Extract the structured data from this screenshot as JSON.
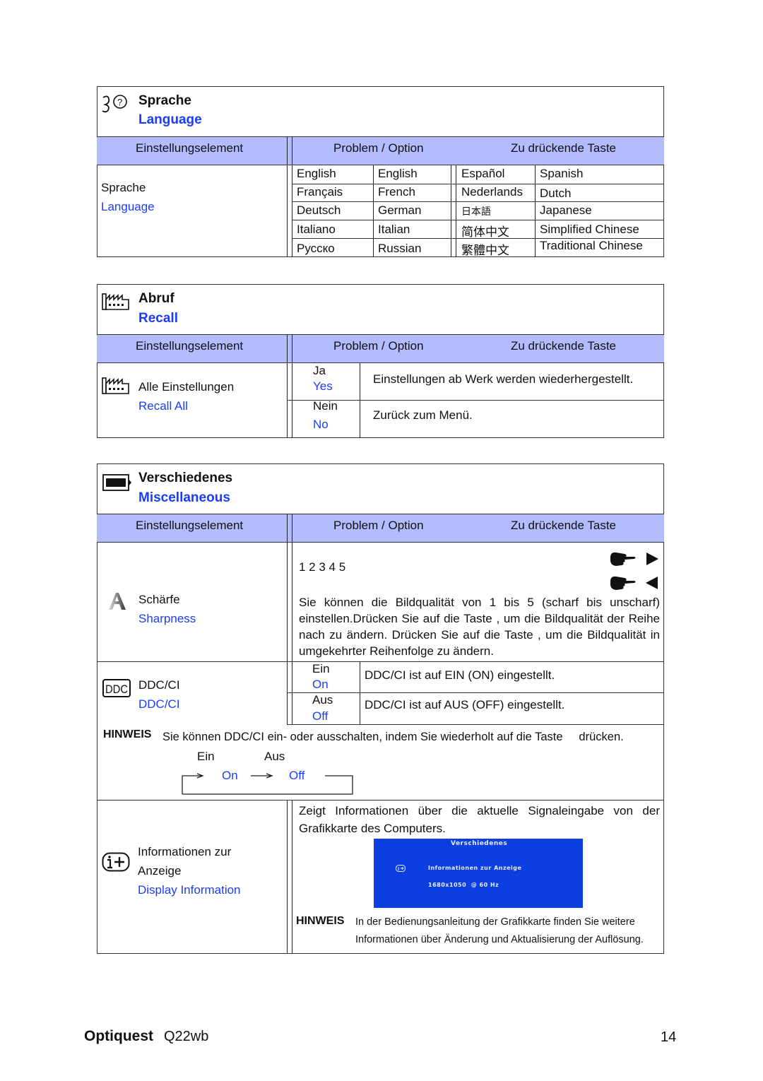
{
  "table_headers": {
    "setting": "Einstellungselement",
    "problem_option": "Problem / Option",
    "key": "Zu drückende Taste"
  },
  "language_section": {
    "icon": "language-question-icon",
    "title_de": "Sprache",
    "title_en": "Language",
    "item_de": "Sprache",
    "item_en": "Language",
    "languages": [
      {
        "native": "English",
        "english": "English"
      },
      {
        "native": "Français",
        "english": "French"
      },
      {
        "native": "Deutsch",
        "english": "German"
      },
      {
        "native": "Italiano",
        "english": "Italian"
      },
      {
        "native": "Pусско",
        "english": "Russian"
      },
      {
        "native": "Español",
        "english": "Spanish"
      },
      {
        "native": "Nederlands",
        "english": "Dutch"
      },
      {
        "native": "日本語",
        "english": "Japanese"
      },
      {
        "native": "简体中文",
        "english": "Simplified Chinese"
      },
      {
        "native": "繁體中文",
        "english": "Traditional Chinese"
      }
    ]
  },
  "recall_section": {
    "icon": "factory-recall-icon",
    "title_de": "Abruf",
    "title_en": "Recall",
    "item_de": "Alle Einstellungen",
    "item_en": "Recall All",
    "options": [
      {
        "de": "Ja",
        "en": "Yes",
        "desc": "Einstellungen ab Werk werden wiederhergestellt."
      },
      {
        "de": "Nein",
        "en": "No",
        "desc": "Zurück zum Menü."
      }
    ]
  },
  "misc_section": {
    "icon": "misc-battery-icon",
    "title_de": "Verschiedenes",
    "title_en": "Miscellaneous",
    "sharpness": {
      "icon": "sharpness-a-icon",
      "item_de": "Schärfe",
      "item_en": "Sharpness",
      "scale": "1 2 3 4 5",
      "desc": "Sie können die Bildqualität von 1 bis 5 (scharf bis unscharf) einstellen.Drücken Sie auf die Taste     , um die Bildqualität der Reihe nach zu ändern. Drücken Sie auf die Taste     , um die Bildqualität in umgekehrter Reihenfolge zu ändern."
    },
    "ddcci": {
      "icon": "ddc-icon",
      "item_de": "DDC/CI",
      "item_en": "DDC/CI",
      "options": [
        {
          "de": "Ein",
          "en": "On",
          "desc": "DDC/CI ist auf EIN (ON) eingestellt."
        },
        {
          "de": "Aus",
          "en": "Off",
          "desc": "DDC/CI ist auf AUS (OFF) eingestellt."
        }
      ],
      "note_label": "HINWEIS",
      "note_text": "Sie können DDC/CI ein- oder ausschalten, indem Sie wiederholt auf die Taste     drücken.",
      "cycle": {
        "on_de": "Ein",
        "off_de": "Aus",
        "on_en": "On",
        "off_en": "Off"
      }
    },
    "display_info": {
      "icon": "info-plus-icon",
      "item_de_line1": "Informationen zur",
      "item_de_line2": "Anzeige",
      "item_en": "Display Information",
      "desc": "Zeigt Informationen über die aktuelle Signaleingabe von der Grafikkarte des Computers.",
      "osd": {
        "title": "Verschiedenes",
        "item": "Informationen zur Anzeige",
        "resolution": "1680x1050  @ 60 Hz",
        "bg_color": "#0b3fe0"
      },
      "note_label": "HINWEIS",
      "note_line1": "In der Bedienungsanleitung der Grafikkarte finden Sie weitere",
      "note_line2": "Informationen über Änderung und Aktualisierung der Auflösung."
    }
  },
  "footer": {
    "brand": "Optiquest",
    "model": "Q22wb",
    "page_number": "14"
  },
  "colors": {
    "header_bg": "#b3bcff",
    "english_text": "#1a3cff"
  }
}
